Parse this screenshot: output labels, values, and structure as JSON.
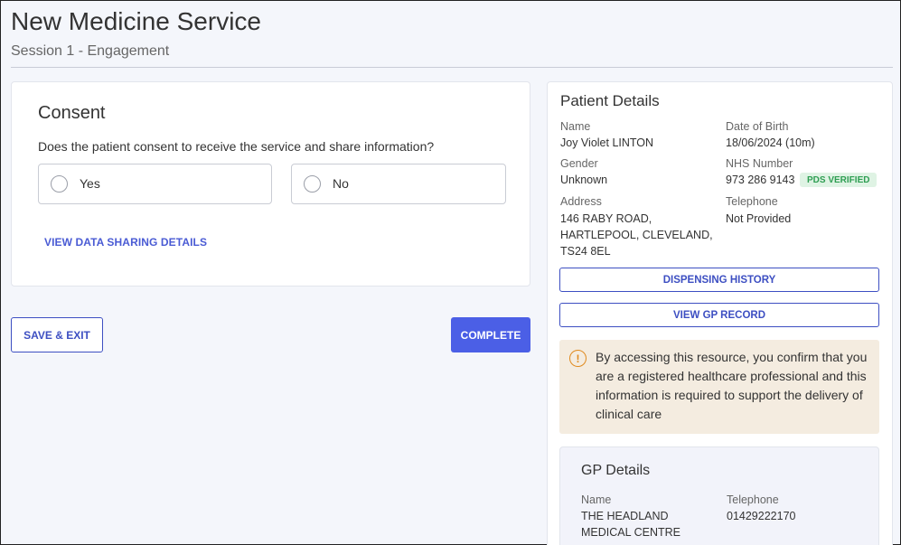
{
  "page": {
    "title": "New Medicine Service",
    "subtitle": "Session 1 - Engagement"
  },
  "consent": {
    "title": "Consent",
    "question": "Does the patient consent to receive the service and share information?",
    "options": [
      {
        "label": "Yes",
        "selected": false
      },
      {
        "label": "No",
        "selected": false
      }
    ],
    "data_sharing_link": "VIEW DATA SHARING DETAILS"
  },
  "actions": {
    "save_exit": "SAVE & EXIT",
    "complete": "COMPLETE"
  },
  "patient": {
    "title": "Patient Details",
    "name_label": "Name",
    "name": "Joy Violet LINTON",
    "dob_label": "Date of Birth",
    "dob": "18/06/2024 (10m)",
    "gender_label": "Gender",
    "gender": "Unknown",
    "nhs_label": "NHS Number",
    "nhs": "973 286 9143",
    "nhs_badge": "PDS VERIFIED",
    "address_label": "Address",
    "address_line1": "146 RABY ROAD,",
    "address_line2": "HARTLEPOOL, CLEVELAND,",
    "address_line3": "TS24 8EL",
    "telephone_label": "Telephone",
    "telephone": "Not Provided",
    "dispensing_history": "DISPENSING HISTORY",
    "view_gp_record": "VIEW GP RECORD",
    "warning": "By accessing this resource, you confirm that you are a registered healthcare professional and this information is required to support the delivery of clinical care",
    "warning_icon": "!"
  },
  "gp": {
    "title": "GP Details",
    "name_label": "Name",
    "name_line1": "THE HEADLAND",
    "name_line2": "MEDICAL CENTRE",
    "telephone_label": "Telephone",
    "telephone": "01429222170"
  },
  "colors": {
    "primary": "#4b5fe6",
    "badge_bg": "#dff3e4",
    "badge_text": "#2e9e52",
    "warning_bg": "#f4ece0",
    "warning_icon": "#e08a1e"
  }
}
